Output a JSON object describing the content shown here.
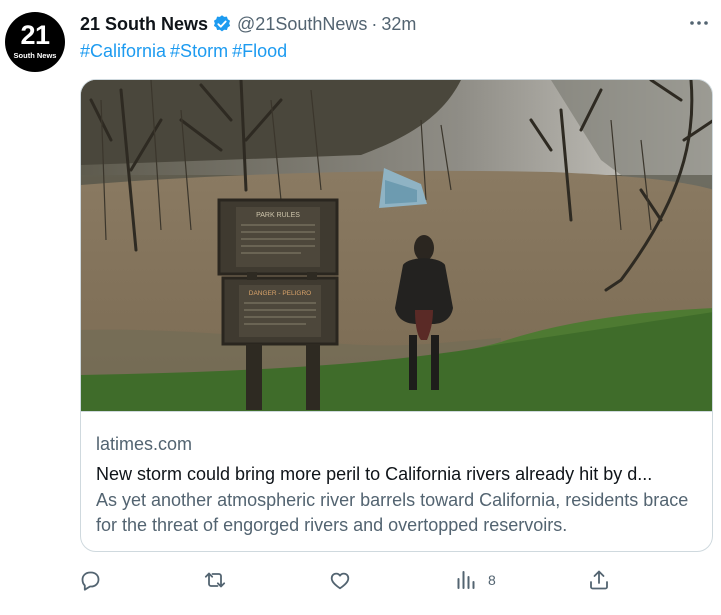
{
  "author": {
    "avatar_big": "21",
    "avatar_small": "South News",
    "name": "21 South News",
    "handle": "@21SouthNews",
    "separator": "·",
    "time": "32m"
  },
  "hashtags": [
    "#California",
    "#Storm",
    "#Flood"
  ],
  "card": {
    "sign_top": "PARK RULES",
    "sign_bottom": "DANGER - PELIGRO",
    "domain": "latimes.com",
    "headline": "New storm could bring more peril to California rivers already hit by d...",
    "description": "As yet another atmospheric river barrels toward California, residents brace for the threat of engorged rivers and overtopped reservoirs."
  },
  "actions": {
    "views_count": "8"
  },
  "colors": {
    "accent": "#1d9bf0",
    "text": "#0f1419",
    "secondary": "#536471",
    "border": "#cfd9de"
  },
  "icons": [
    "verified-badge-icon",
    "more-icon",
    "reply-icon",
    "retweet-icon",
    "like-icon",
    "views-icon",
    "share-icon"
  ]
}
